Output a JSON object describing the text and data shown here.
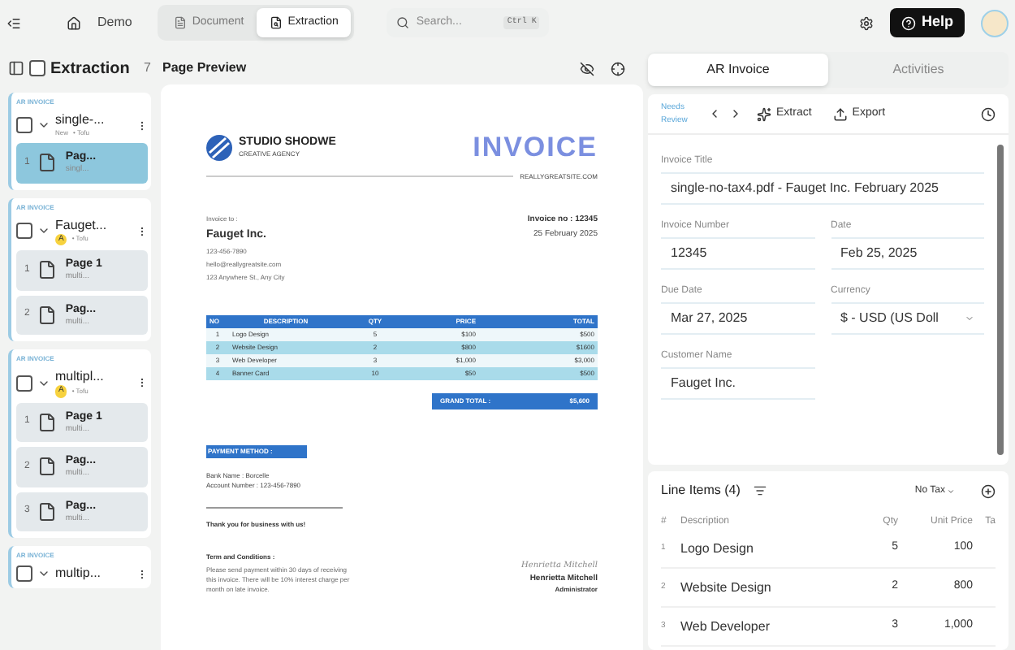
{
  "topbar": {
    "breadcrumb": "Demo",
    "tabs": [
      {
        "label": "Document",
        "selected": false
      },
      {
        "label": "Extraction",
        "selected": true
      }
    ],
    "search": {
      "placeholder": "Search...",
      "shortcut": "Ctrl K"
    },
    "help": "Help"
  },
  "sidebar": {
    "title": "Extraction",
    "checked": false,
    "count": "7",
    "groups": [
      {
        "tag": "AR INVOICE",
        "checked": false,
        "title": "single-...",
        "status": "New",
        "owner": "• Tofu",
        "pages": [
          {
            "number": "1",
            "title": "Pag...",
            "subtitle": "singl...",
            "selected": true
          }
        ]
      },
      {
        "tag": "AR INVOICE",
        "checked": false,
        "title": "Fauget...",
        "badge": "A",
        "owner": "• Tofu",
        "pages": [
          {
            "number": "1",
            "title": "Page 1",
            "subtitle": "multi...",
            "selected": false
          },
          {
            "number": "2",
            "title": "Pag...",
            "subtitle": "multi...",
            "selected": false
          }
        ]
      },
      {
        "tag": "AR INVOICE",
        "checked": false,
        "title": "multipl...",
        "badge": "A",
        "owner": "• Tofu",
        "pages": [
          {
            "number": "1",
            "title": "Page 1",
            "subtitle": "multi...",
            "selected": false
          },
          {
            "number": "2",
            "title": "Pag...",
            "subtitle": "multi...",
            "selected": false
          },
          {
            "number": "3",
            "title": "Pag...",
            "subtitle": "multi...",
            "selected": false
          }
        ]
      },
      {
        "tag": "AR INVOICE",
        "checked": false,
        "title": "multip..."
      }
    ]
  },
  "preview": {
    "title": "Page Preview",
    "document": {
      "company": "STUDIO SHODWE",
      "tagline": "CREATIVE AGENCY",
      "heading": "INVOICE",
      "website": "REALLYGREATSITE.COM",
      "to_label": "Invoice to :",
      "to_name": "Fauget Inc.",
      "to_lines": [
        "123-456-7890",
        "hello@reallygreatsite.com",
        "123 Anywhere St., Any City"
      ],
      "invoice_no": "Invoice no : 12345",
      "date": "25 February 2025",
      "table": {
        "columns": [
          "NO",
          "DESCRIPTION",
          "QTY",
          "PRICE",
          "TOTAL"
        ],
        "rows": [
          [
            "1",
            "Logo Design",
            "5",
            "$100",
            "$500"
          ],
          [
            "2",
            "Website Design",
            "2",
            "$800",
            "$1600"
          ],
          [
            "3",
            "Web Developer",
            "3",
            "$1,000",
            "$3,000"
          ],
          [
            "4",
            "Banner Card",
            "10",
            "$50",
            "$500"
          ]
        ]
      },
      "grand_total_label": "GRAND TOTAL :",
      "grand_total": "$5,600",
      "payment_label": "PAYMENT METHOD :",
      "payment_lines": [
        "Bank Name : Borcelle",
        "Account Number : 123-456-7890"
      ],
      "thanks": "Thank you for business with us!",
      "terms_label": "Term and Conditions :",
      "terms": "Please send payment within 30 days of receiving this invoice. There will be 10% interest charge per month on late invoice.",
      "signature": "Henrietta Mitchell",
      "signer": "Henrietta Mitchell",
      "signer_role": "Administrator"
    }
  },
  "panel": {
    "tabs": [
      {
        "label": "AR Invoice",
        "selected": true
      },
      {
        "label": "Activities",
        "selected": false
      }
    ],
    "status": "Needs Review",
    "extract": "Extract",
    "export": "Export",
    "fields": [
      {
        "label": "Invoice Title",
        "value": "single-no-tax4.pdf - Fauget Inc. February 2025",
        "kind": "text",
        "wide": true
      },
      {
        "label": "Invoice Number",
        "value": "12345",
        "kind": "text",
        "wide": false
      },
      {
        "label": "Date",
        "value": "Feb 25, 2025",
        "kind": "text",
        "wide": false
      },
      {
        "label": "Due Date",
        "value": "Mar 27, 2025",
        "kind": "text",
        "wide": false
      },
      {
        "label": "Currency",
        "value": "$ - USD (US Doll",
        "kind": "select",
        "wide": false
      },
      {
        "label": "Customer Name",
        "value": "Fauget Inc.",
        "kind": "text",
        "wide": false
      }
    ],
    "line_items": {
      "title": "Line Items (4)",
      "tax": "No Tax",
      "columns": [
        "#",
        "Description",
        "Qty",
        "Unit Price",
        "Ta"
      ],
      "rows": [
        [
          "1",
          "Logo Design",
          "5",
          "100"
        ],
        [
          "2",
          "Website Design",
          "2",
          "800"
        ],
        [
          "3",
          "Web Developer",
          "3",
          "1,000"
        ]
      ]
    }
  }
}
